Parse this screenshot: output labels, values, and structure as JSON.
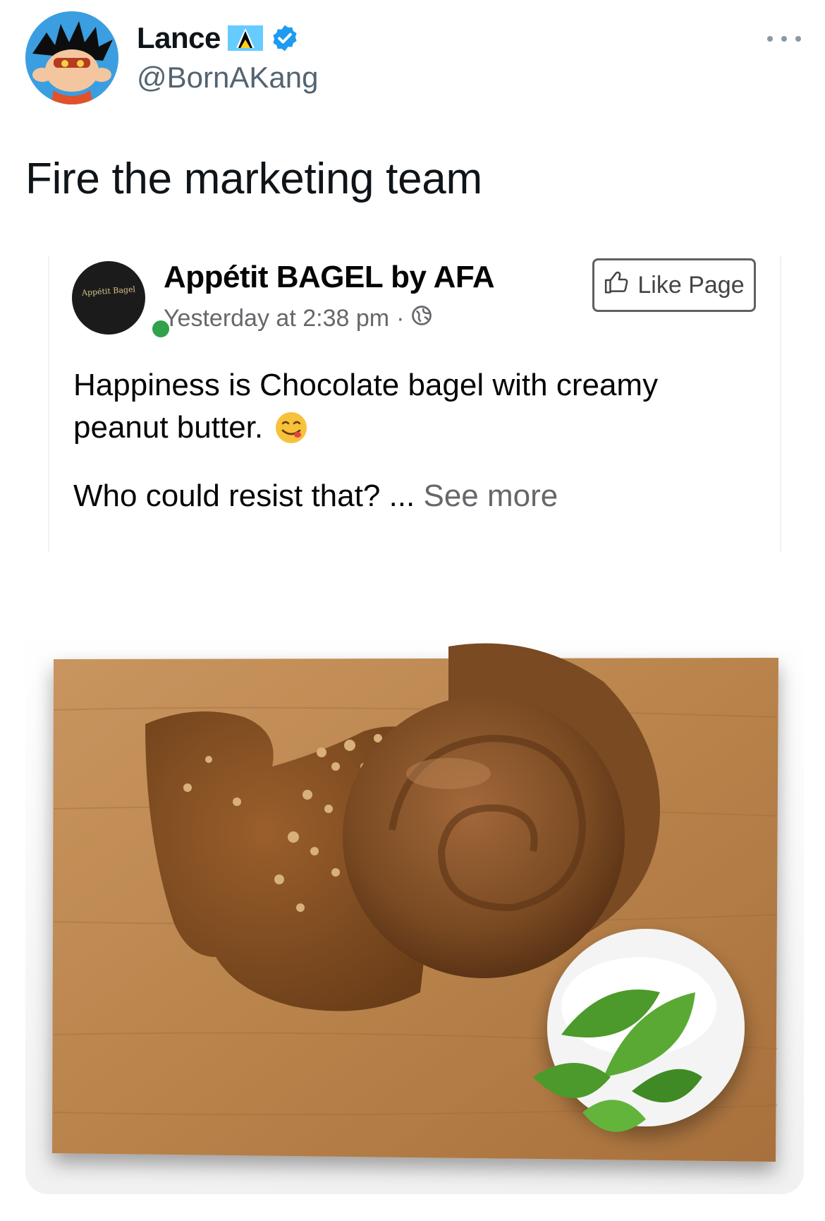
{
  "tweet": {
    "display_name": "Lance",
    "handle": "@BornAKang",
    "text": "Fire the marketing team"
  },
  "embedded_post": {
    "avatar_text": "Appétit Bagel",
    "page_name": "Appétit BAGEL by AFA",
    "time": "Yesterday at 2:38 pm",
    "separator": "·",
    "like_page_label": "Like Page",
    "body_line1": "Happiness is Chocolate bagel with creamy",
    "body_line2": "peanut butter.",
    "question": "Who could resist that?",
    "ellipsis": "...",
    "see_more": "See more"
  },
  "colors": {
    "verified": "#1d9bf0",
    "muted": "#536471",
    "fb_muted": "#65676b",
    "online": "#31a24c"
  },
  "icons": [
    "saint-lucia-flag-icon",
    "verified-badge-icon",
    "more-icon",
    "globe-icon",
    "thumbs-up-icon",
    "smiling-emoji-icon"
  ]
}
